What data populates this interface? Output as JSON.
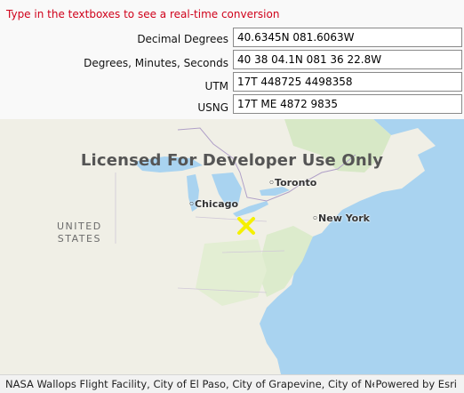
{
  "hint": "Type in the textboxes to see a real-time conversion",
  "fields": [
    {
      "label": "Decimal Degrees",
      "value": "40.6345N 081.6063W"
    },
    {
      "label": "Degrees, Minutes, Seconds",
      "value": "40 38 04.1N 081 36 22.8W"
    },
    {
      "label": "UTM",
      "value": "17T 448725 4498358"
    },
    {
      "label": "USNG",
      "value": "17T ME 4872 9835"
    }
  ],
  "map": {
    "watermark": "Licensed For Developer Use Only",
    "cities": [
      "Toronto",
      "Chicago",
      "New York"
    ],
    "country_line1": "UNITED",
    "country_line2": "STATES",
    "marker_icon": "x-marker-icon",
    "marker_color": "#ffff00"
  },
  "footer": {
    "attribution": "NASA Wallops Flight Facility, City of El Paso, City of Grapevine, City of Newto...",
    "powered_by": "Powered by Esri"
  }
}
